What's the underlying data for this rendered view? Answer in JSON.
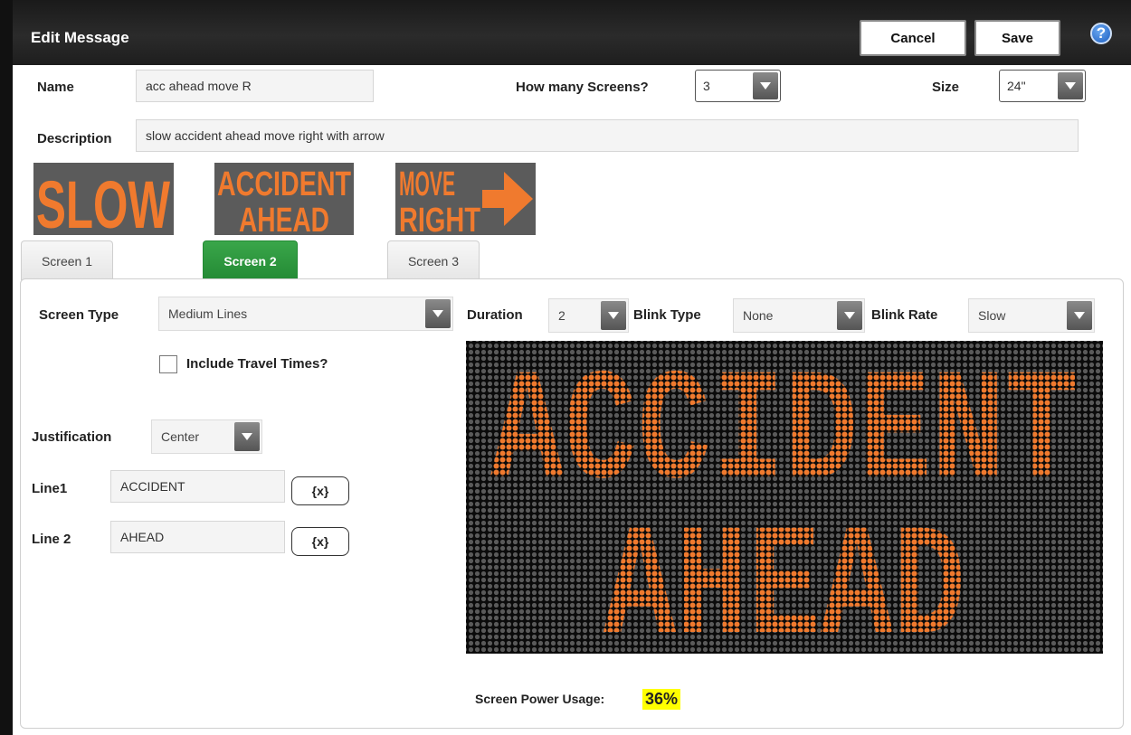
{
  "window": {
    "title": "Edit Message",
    "cancel_label": "Cancel",
    "save_label": "Save",
    "help_glyph": "?"
  },
  "form": {
    "name_label": "Name",
    "name_value": "acc ahead move R",
    "screens_label": "How many Screens?",
    "screens_value": "3",
    "size_label": "Size",
    "size_value": "24\"",
    "description_label": "Description",
    "description_value": "slow accident ahead move right with arrow"
  },
  "thumbnails": [
    {
      "lines": [
        "SLOW"
      ]
    },
    {
      "lines": [
        "ACCIDENT",
        "AHEAD"
      ]
    },
    {
      "lines": [
        "MOVE",
        "RIGHT"
      ],
      "arrow": true
    }
  ],
  "tabs": [
    {
      "label": "Screen 1",
      "active": false
    },
    {
      "label": "Screen 2",
      "active": true
    },
    {
      "label": "Screen 3",
      "active": false
    }
  ],
  "screen": {
    "type_label": "Screen Type",
    "type_value": "Medium Lines",
    "travel_label": "Include Travel Times?",
    "travel_checked": false,
    "justification_label": "Justification",
    "justification_value": "Center",
    "line1_label": "Line1",
    "line1_value": "ACCIDENT",
    "line2_label": "Line 2",
    "line2_value": "AHEAD",
    "var_button": "{x}",
    "duration_label": "Duration",
    "duration_value": "2",
    "blink_type_label": "Blink Type",
    "blink_type_value": "None",
    "blink_rate_label": "Blink Rate",
    "blink_rate_value": "Slow",
    "power_label": "Screen Power Usage:",
    "power_value": "36%"
  },
  "colors": {
    "led_on": "#f07a2e",
    "led_off": "#5a5a5a",
    "sign_bg": "#0b0b0b",
    "tab_active": "#2e9a3e",
    "power_highlight": "#ffff00"
  }
}
